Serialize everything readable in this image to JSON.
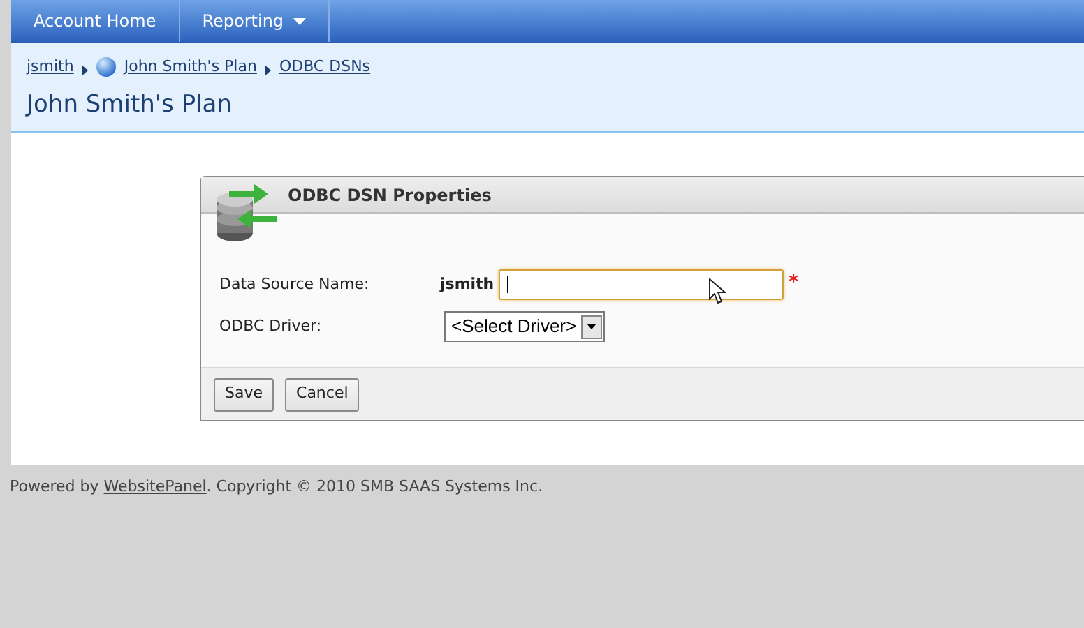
{
  "nav": [
    {
      "label": "Account Home",
      "kind": "link"
    },
    {
      "label": "Reporting",
      "kind": "menu"
    }
  ],
  "breadcrumb": [
    {
      "label": "jsmith",
      "kind": "plain"
    },
    {
      "label": "John Smith's Plan",
      "kind": "globe"
    },
    {
      "label": "ODBC DSNs",
      "kind": "plain"
    }
  ],
  "page_title": "John Smith's Plan",
  "panel": {
    "title": "ODBC DSN Properties",
    "fields": [
      {
        "label": "Data Source Name:",
        "kind": "text",
        "prefix": "jsmith",
        "focused": true,
        "required_mark": "*"
      },
      {
        "label": "ODBC Driver:",
        "kind": "select",
        "value": "<Select Driver>"
      }
    ],
    "buttons": [
      "Save",
      "Cancel"
    ]
  },
  "footer": {
    "before": "Powered by ",
    "link": "WebsitePanel",
    "after": ". Copyright © 2010 SMB SAAS Systems Inc."
  }
}
